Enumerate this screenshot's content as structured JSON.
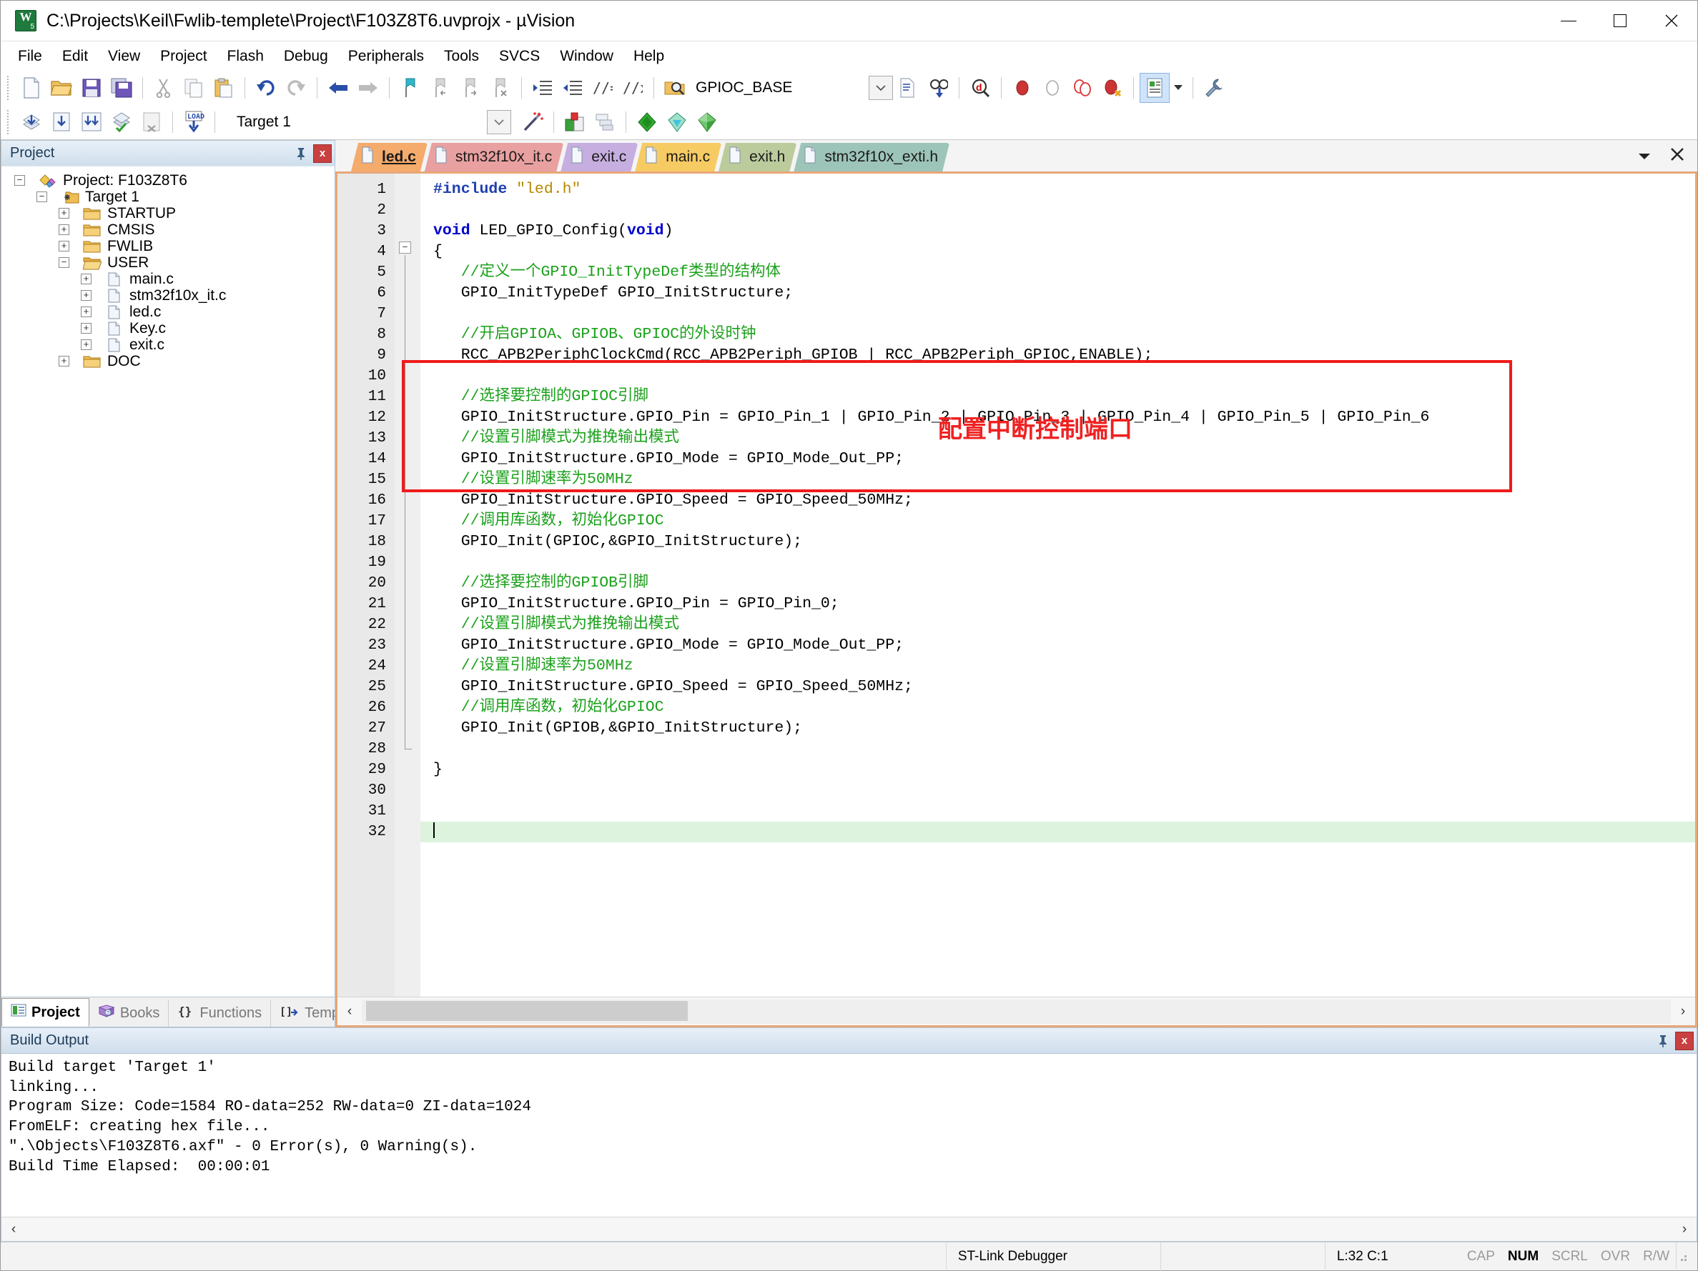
{
  "window": {
    "title": "C:\\Projects\\Keil\\Fwlib-templete\\Project\\F103Z8T6.uvprojx - µVision",
    "app_icon": "uvision-logo-icon",
    "minimize": "—",
    "maximize": "□",
    "close": "✕"
  },
  "menu": {
    "items": [
      "File",
      "Edit",
      "View",
      "Project",
      "Flash",
      "Debug",
      "Peripherals",
      "Tools",
      "SVCS",
      "Window",
      "Help"
    ]
  },
  "toolbar1": {
    "icons": [
      "new-file-icon",
      "open-file-icon",
      "save-icon",
      "save-all-icon",
      "cut-icon",
      "copy-icon",
      "paste-icon",
      "undo-icon",
      "redo-icon",
      "navigate-back-icon",
      "navigate-forward-icon",
      "bookmark-toggle-icon",
      "bookmark-prev-icon",
      "bookmark-next-icon",
      "bookmark-clear-icon",
      "indent-right-icon",
      "indent-left-icon",
      "comment-icon",
      "uncomment-icon"
    ]
  },
  "toolbar2": {
    "icons": [
      "build-icon",
      "rebuild-icon",
      "batch-build-icon",
      "translate-icon",
      "stop-build-icon",
      "download-icon"
    ],
    "target_value": "Target 1",
    "target_placeholder": "Target 1",
    "manage_project_icon": "magic-wand-icon",
    "right_icons": [
      "target-options-icon",
      "manage-components-icon",
      "debug-start-icon",
      "insert-filter-icon",
      "configuration-wizard-icon"
    ]
  },
  "find_toolbar": {
    "icon": "find-in-files-icon",
    "search_value": "GPIOC_BASE",
    "search_placeholder": "GPIOC_BASE",
    "dropdown_icon": "chevron-down-icon",
    "icons": [
      "find-in-files-icon",
      "goto-definition-icon",
      "browse-symbols-icon",
      "insert-breakpoint-icon",
      "disable-breakpoint-icon",
      "kill-all-breakpoints-icon",
      "disable-all-breakpoints-icon",
      "configuration-wizard-toggle-icon",
      "customize-tools-icon"
    ]
  },
  "project_pane": {
    "title": "Project",
    "pin_icon": "pin-icon",
    "close_icon": "close-icon",
    "tree": [
      {
        "indent": 0,
        "expander": "-",
        "icon": "project-icon",
        "label": "Project: F103Z8T6"
      },
      {
        "indent": 1,
        "expander": "-",
        "icon": "target-folder-icon",
        "label": "Target 1"
      },
      {
        "indent": 2,
        "expander": "+",
        "icon": "folder-icon",
        "label": "STARTUP"
      },
      {
        "indent": 2,
        "expander": "+",
        "icon": "folder-icon",
        "label": "CMSIS"
      },
      {
        "indent": 2,
        "expander": "+",
        "icon": "folder-icon",
        "label": "FWLIB"
      },
      {
        "indent": 2,
        "expander": "-",
        "icon": "folder-open-icon",
        "label": "USER"
      },
      {
        "indent": 3,
        "expander": "+",
        "icon": "c-file-icon",
        "label": "main.c"
      },
      {
        "indent": 3,
        "expander": "+",
        "icon": "c-file-icon",
        "label": "stm32f10x_it.c"
      },
      {
        "indent": 3,
        "expander": "+",
        "icon": "c-file-icon",
        "label": "led.c"
      },
      {
        "indent": 3,
        "expander": "+",
        "icon": "c-file-icon",
        "label": "Key.c"
      },
      {
        "indent": 3,
        "expander": "+",
        "icon": "c-file-icon",
        "label": "exit.c"
      },
      {
        "indent": 2,
        "expander": "+",
        "icon": "folder-icon",
        "label": "DOC"
      }
    ],
    "bottom_tabs": [
      {
        "label": "Project",
        "icon": "project-view-icon",
        "active": true
      },
      {
        "label": "Books",
        "icon": "books-icon",
        "active": false
      },
      {
        "label": "Functions",
        "icon": "functions-icon",
        "active": false
      },
      {
        "label": "Templates",
        "icon": "templates-icon",
        "active": false
      }
    ]
  },
  "editor": {
    "tabs": [
      {
        "label": "led.c",
        "color": "#f5ab6c",
        "active": true
      },
      {
        "label": "stm32f10x_it.c",
        "color": "#e9a0a0",
        "active": false
      },
      {
        "label": "exit.c",
        "color": "#c7aee0",
        "active": false
      },
      {
        "label": "main.c",
        "color": "#f7cb63",
        "active": false
      },
      {
        "label": "exit.h",
        "color": "#bccb9c",
        "active": false
      },
      {
        "label": "stm32f10x_exti.h",
        "color": "#9dc4b8",
        "active": false
      }
    ],
    "tab_menu_icon": "chevron-down-icon",
    "tab_close_icon": "close-icon",
    "total_lines": 32,
    "current_line": 32,
    "lines": [
      {
        "n": 1,
        "tokens": [
          {
            "t": "#include ",
            "c": "pp"
          },
          {
            "t": "\"led.h\"",
            "c": "str"
          }
        ]
      },
      {
        "n": 2,
        "tokens": []
      },
      {
        "n": 3,
        "tokens": [
          {
            "t": "void ",
            "c": "kw"
          },
          {
            "t": "LED_GPIO_Config(",
            "c": "txt"
          },
          {
            "t": "void",
            "c": "kw"
          },
          {
            "t": ")",
            "c": "txt"
          }
        ]
      },
      {
        "n": 4,
        "tokens": [
          {
            "t": "{",
            "c": "txt"
          }
        ]
      },
      {
        "n": 5,
        "tokens": [
          {
            "t": "   //定义一个GPIO_InitTypeDef类型的结构体",
            "c": "cm"
          }
        ]
      },
      {
        "n": 6,
        "tokens": [
          {
            "t": "   GPIO_InitTypeDef GPIO_InitStructure;",
            "c": "txt"
          }
        ]
      },
      {
        "n": 7,
        "tokens": []
      },
      {
        "n": 8,
        "tokens": [
          {
            "t": "   //开启GPIOA、GPIOB、GPIOC的外设时钟",
            "c": "cm"
          }
        ]
      },
      {
        "n": 9,
        "tokens": [
          {
            "t": "   RCC_APB2PeriphClockCmd(RCC_APB2Periph_GPIOB | RCC_APB2Periph_GPIOC,ENABLE);",
            "c": "txt"
          }
        ]
      },
      {
        "n": 10,
        "tokens": []
      },
      {
        "n": 11,
        "tokens": [
          {
            "t": "   //选择要控制的GPIOC引脚",
            "c": "cm"
          }
        ]
      },
      {
        "n": 12,
        "tokens": [
          {
            "t": "   GPIO_InitStructure.GPIO_Pin = GPIO_Pin_1 | GPIO_Pin_2 | GPIO_Pin_3 | GPIO_Pin_4 | GPIO_Pin_5 | GPIO_Pin_6",
            "c": "txt"
          }
        ]
      },
      {
        "n": 13,
        "tokens": [
          {
            "t": "   //设置引脚模式为推挽输出模式",
            "c": "cm"
          }
        ]
      },
      {
        "n": 14,
        "tokens": [
          {
            "t": "   GPIO_InitStructure.GPIO_Mode = GPIO_Mode_Out_PP;",
            "c": "txt"
          }
        ]
      },
      {
        "n": 15,
        "tokens": [
          {
            "t": "   //设置引脚速率为50MHz",
            "c": "cm"
          }
        ]
      },
      {
        "n": 16,
        "tokens": [
          {
            "t": "   GPIO_InitStructure.GPIO_Speed = GPIO_Speed_50MHz;",
            "c": "txt"
          }
        ]
      },
      {
        "n": 17,
        "tokens": [
          {
            "t": "   //调用库函数，初始化GPIOC",
            "c": "cm"
          }
        ]
      },
      {
        "n": 18,
        "tokens": [
          {
            "t": "   GPIO_Init(GPIOC,&GPIO_InitStructure);",
            "c": "txt"
          }
        ]
      },
      {
        "n": 19,
        "tokens": []
      },
      {
        "n": 20,
        "tokens": [
          {
            "t": "   //选择要控制的GPIOB引脚",
            "c": "cm"
          }
        ]
      },
      {
        "n": 21,
        "tokens": [
          {
            "t": "   GPIO_InitStructure.GPIO_Pin = GPIO_Pin_0;",
            "c": "txt"
          }
        ]
      },
      {
        "n": 22,
        "tokens": [
          {
            "t": "   //设置引脚模式为推挽输出模式",
            "c": "cm"
          }
        ]
      },
      {
        "n": 23,
        "tokens": [
          {
            "t": "   GPIO_InitStructure.GPIO_Mode = GPIO_Mode_Out_PP;",
            "c": "txt"
          }
        ]
      },
      {
        "n": 24,
        "tokens": [
          {
            "t": "   //设置引脚速率为50MHz",
            "c": "cm"
          }
        ]
      },
      {
        "n": 25,
        "tokens": [
          {
            "t": "   GPIO_InitStructure.GPIO_Speed = GPIO_Speed_50MHz;",
            "c": "txt"
          }
        ]
      },
      {
        "n": 26,
        "tokens": [
          {
            "t": "   //调用库函数，初始化GPIOC",
            "c": "cm"
          }
        ]
      },
      {
        "n": 27,
        "tokens": [
          {
            "t": "   GPIO_Init(GPIOB,&GPIO_InitStructure);",
            "c": "txt"
          }
        ]
      },
      {
        "n": 28,
        "tokens": []
      },
      {
        "n": 29,
        "tokens": [
          {
            "t": "}",
            "c": "txt"
          }
        ]
      },
      {
        "n": 30,
        "tokens": []
      },
      {
        "n": 31,
        "tokens": []
      },
      {
        "n": 32,
        "tokens": [],
        "current": true
      }
    ],
    "annotation": {
      "text": "配置中断控制端口",
      "color": "#ef2222",
      "box_color": "#ef1b1b",
      "covers_lines": "20-28"
    },
    "hscroll": {
      "left_arrow": "‹",
      "right_arrow": "›"
    }
  },
  "build_output": {
    "title": "Build Output",
    "pin_icon": "pin-icon",
    "close_icon": "close-icon",
    "lines": [
      "Build target 'Target 1'",
      "linking...",
      "Program Size: Code=1584 RO-data=252 RW-data=0 ZI-data=1024",
      "FromELF: creating hex file...",
      "\".\\Objects\\F103Z8T6.axf\" - 0 Error(s), 0 Warning(s).",
      "Build Time Elapsed:  00:00:01"
    ]
  },
  "statusbar": {
    "debugger": "ST-Link Debugger",
    "position": "L:32 C:1",
    "indicators": [
      {
        "label": "CAP",
        "on": false
      },
      {
        "label": "NUM",
        "on": true
      },
      {
        "label": "SCRL",
        "on": false
      },
      {
        "label": "OVR",
        "on": false
      },
      {
        "label": "R/W",
        "on": false
      }
    ]
  }
}
